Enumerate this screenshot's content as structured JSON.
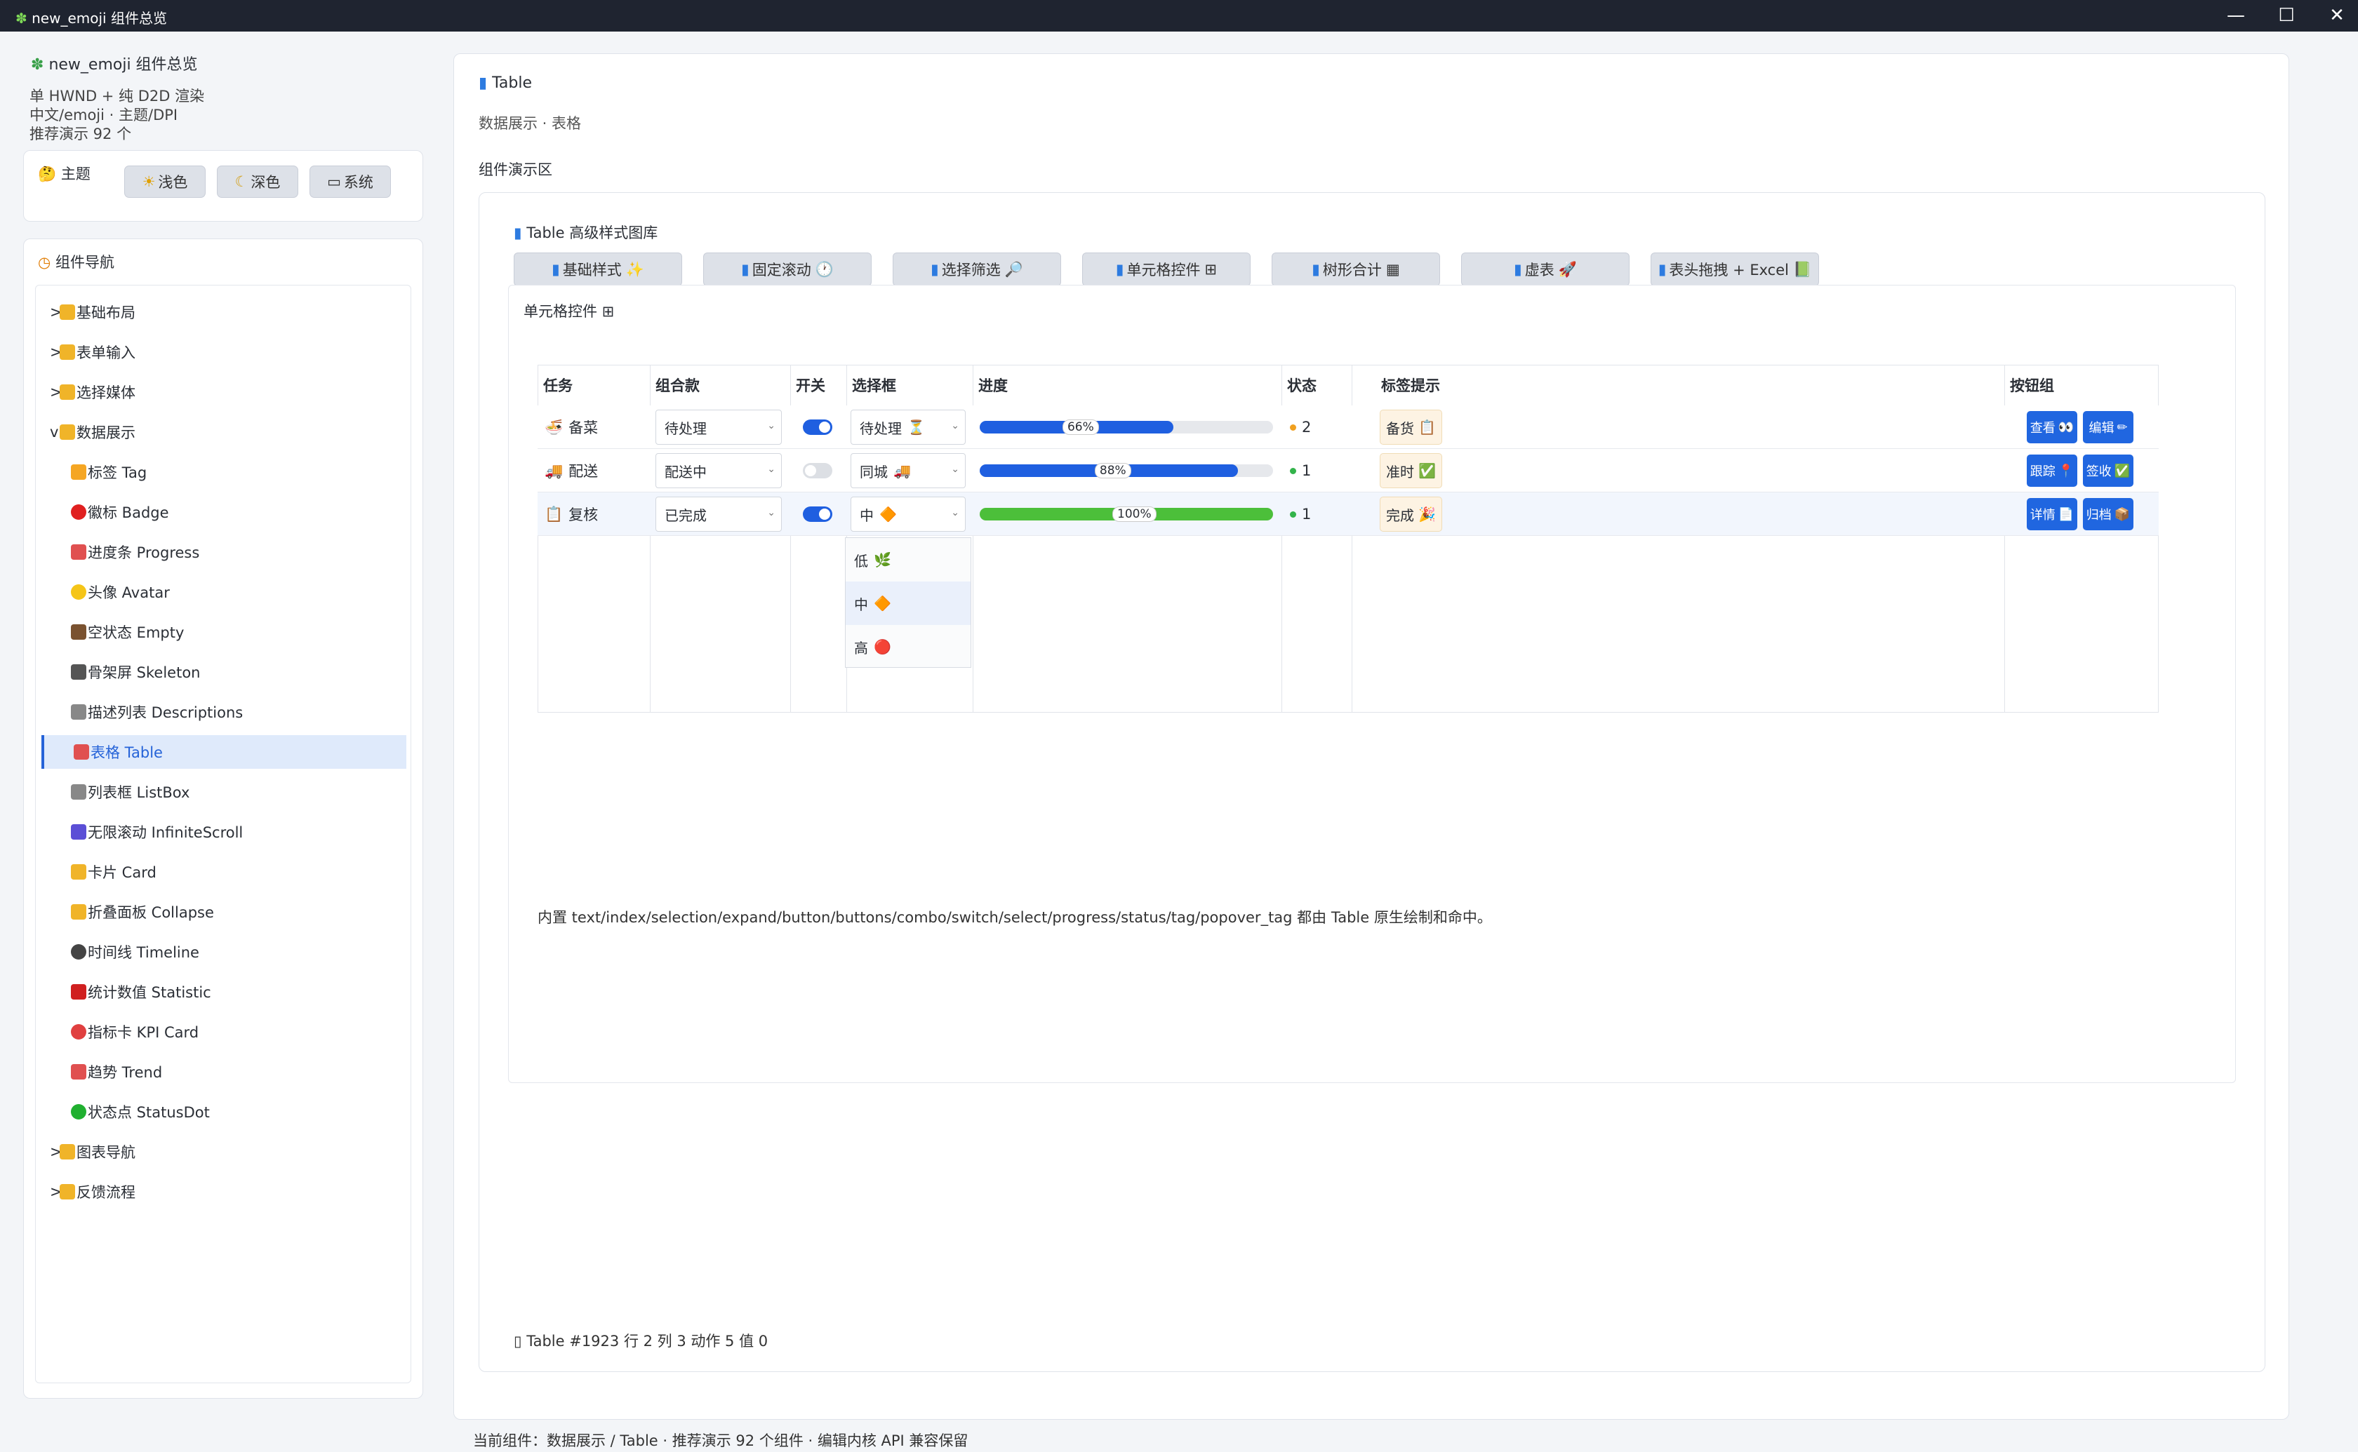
{
  "window": {
    "title": "new_emoji 组件总览",
    "minimize": "—",
    "maximize": "☐",
    "close": "✕"
  },
  "sidebar": {
    "app_title": "new_emoji 组件总览",
    "subtitle_lines": [
      "单 HWND + 纯 D2D 渲染",
      "中文/emoji · 主题/DPI",
      "推荐演示 92 个"
    ],
    "theme": {
      "title": "主题",
      "buttons": [
        {
          "label": "浅色",
          "icon": "☀"
        },
        {
          "label": "深色",
          "icon": "🌙"
        },
        {
          "label": "系统",
          "icon": "💻"
        }
      ]
    },
    "nav": {
      "title": "组件导航",
      "items": [
        {
          "prefix": ">",
          "label": "基础布局",
          "icon": "folder"
        },
        {
          "prefix": ">",
          "label": "表单输入",
          "icon": "folder"
        },
        {
          "prefix": ">",
          "label": "选择媒体",
          "icon": "folder"
        },
        {
          "prefix": "v",
          "label": "数据展示",
          "icon": "folder"
        },
        {
          "prefix": "",
          "label": "标签 Tag",
          "icon": "tag"
        },
        {
          "prefix": "",
          "label": "徽标 Badge",
          "icon": "badge"
        },
        {
          "prefix": "",
          "label": "进度条 Progress",
          "icon": "chart"
        },
        {
          "prefix": "",
          "label": "头像 Avatar",
          "icon": "smile"
        },
        {
          "prefix": "",
          "label": "空状态 Empty",
          "icon": "mailbox"
        },
        {
          "prefix": "",
          "label": "骨架屏 Skeleton",
          "icon": "skull"
        },
        {
          "prefix": "",
          "label": "描述列表 Descriptions",
          "icon": "list"
        },
        {
          "prefix": "",
          "label": "表格 Table",
          "icon": "chart",
          "active": true
        },
        {
          "prefix": "",
          "label": "列表框 ListBox",
          "icon": "list"
        },
        {
          "prefix": "",
          "label": "无限滚动 InfiniteScroll",
          "icon": "infinity"
        },
        {
          "prefix": "",
          "label": "卡片 Card",
          "icon": "card"
        },
        {
          "prefix": "",
          "label": "折叠面板 Collapse",
          "icon": "folder"
        },
        {
          "prefix": "",
          "label": "时间线 Timeline",
          "icon": "clock"
        },
        {
          "prefix": "",
          "label": "统计数值 Statistic",
          "icon": "pin"
        },
        {
          "prefix": "",
          "label": "指标卡 KPI Card",
          "icon": "target"
        },
        {
          "prefix": "",
          "label": "趋势 Trend",
          "icon": "chart"
        },
        {
          "prefix": "",
          "label": "状态点 StatusDot",
          "icon": "green-dot"
        },
        {
          "prefix": ">",
          "label": "图表导航",
          "icon": "folder"
        },
        {
          "prefix": ">",
          "label": "反馈流程",
          "icon": "folder"
        }
      ]
    }
  },
  "main": {
    "title": "Table",
    "subtitle": "数据展示 · 表格",
    "demo_label": "组件演示区",
    "gallery_title": "Table 高级样式图库",
    "tabs": [
      {
        "label": "基础样式",
        "emoji": "✨"
      },
      {
        "label": "固定滚动",
        "emoji": "🕐"
      },
      {
        "label": "选择筛选",
        "emoji": "🔎"
      },
      {
        "label": "单元格控件",
        "emoji": "⊞"
      },
      {
        "label": "树形合计",
        "emoji": "▦"
      },
      {
        "label": "虚表",
        "emoji": "🚀"
      },
      {
        "label": "表头拖拽 + Excel",
        "emoji": "📗"
      }
    ],
    "section_title": "单元格控件",
    "section_icon": "⊞",
    "table": {
      "headers": [
        "任务",
        "组合款",
        "开关",
        "选择框",
        "进度",
        "状态",
        "标签提示",
        "按钮组"
      ],
      "rows": [
        {
          "task_icon": "🍜",
          "task": "备菜",
          "combo": "待处理",
          "switch_on": true,
          "select": "待处理",
          "select_emoji": "⏳",
          "progress": 66,
          "progress_label": "66%",
          "progress_color": "#1f5fe0",
          "status_dot": "#f0a020",
          "status": "2",
          "tag": "备货",
          "tag_emoji": "📋",
          "buttons": [
            {
              "label": "查看",
              "emoji": "👀"
            },
            {
              "label": "编辑",
              "emoji": "✏"
            }
          ]
        },
        {
          "task_icon": "🚚",
          "task": "配送",
          "combo": "配送中",
          "switch_on": false,
          "select": "同城",
          "select_emoji": "🚚",
          "progress": 88,
          "progress_label": "88%",
          "progress_color": "#1f5fe0",
          "status_dot": "#32b34a",
          "status": "1",
          "tag": "准时",
          "tag_emoji": "✅",
          "buttons": [
            {
              "label": "跟踪",
              "emoji": "📍"
            },
            {
              "label": "签收",
              "emoji": "✅"
            }
          ]
        },
        {
          "task_icon": "📋",
          "task": "复核",
          "combo": "已完成",
          "switch_on": true,
          "select": "中",
          "select_emoji": "🔶",
          "progress": 100,
          "progress_label": "100%",
          "progress_color": "#4cbf3a",
          "status_dot": "#32b34a",
          "status": "1",
          "tag": "完成",
          "tag_emoji": "🎉",
          "buttons": [
            {
              "label": "详情",
              "emoji": "📄"
            },
            {
              "label": "归档",
              "emoji": "📦"
            }
          ]
        }
      ],
      "dropdown_options": [
        {
          "label": "低",
          "emoji": "🌿"
        },
        {
          "label": "中",
          "emoji": "🔶"
        },
        {
          "label": "高",
          "emoji": "🔴"
        }
      ]
    },
    "description": "内置 text/index/selection/expand/button/buttons/combo/switch/select/progress/status/tag/popover_tag 都由 Table 原生绘制和命中。",
    "footer_info": "Table #1923 行 2 列 3 动作 5 值 0"
  },
  "statusbar": "当前组件：数据展示 / Table · 推荐演示 92 个组件 · 编辑内核 API 兼容保留",
  "colors": {
    "accent": "#2563d8",
    "button_blue": "#2066e0",
    "progress_green": "#4cbf3a"
  }
}
